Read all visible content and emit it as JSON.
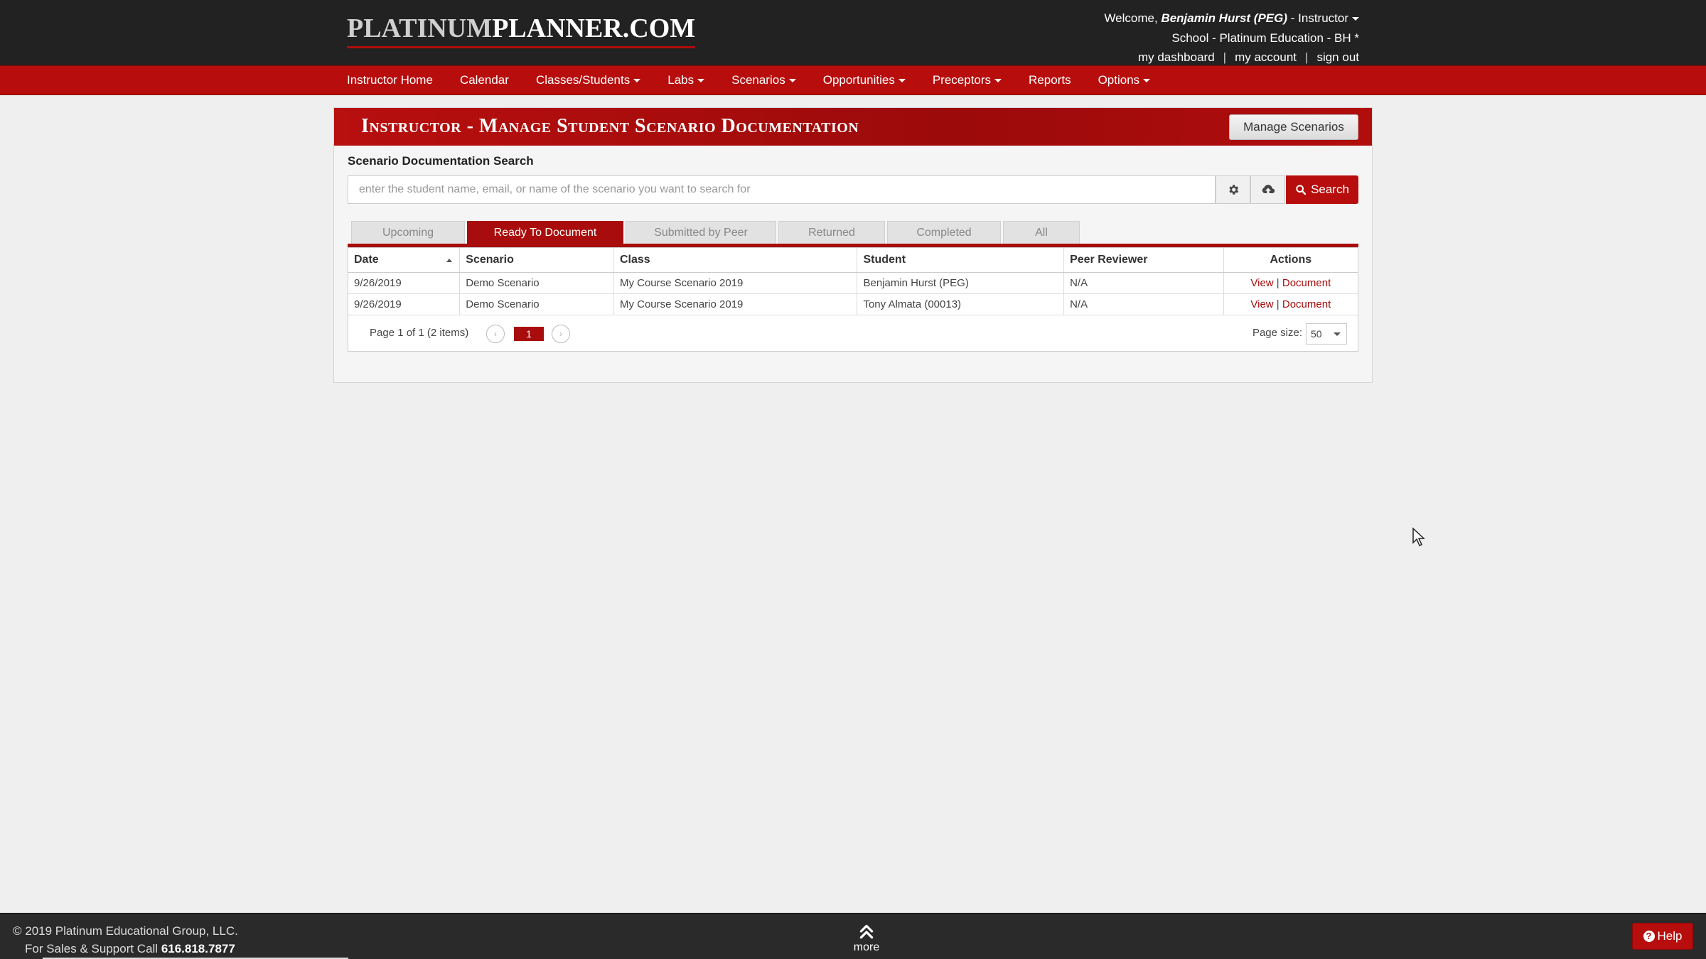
{
  "header": {
    "logo_left": "PLATINUM",
    "logo_right": "PLANNER.COM",
    "welcome_prefix": "Welcome, ",
    "user_name": "Benjamin Hurst (PEG)",
    "user_role": " - Instructor",
    "school": "School - Platinum Education - BH *",
    "links": [
      "my dashboard",
      "my account",
      "sign out"
    ]
  },
  "nav": {
    "items": [
      {
        "label": "Instructor Home",
        "dropdown": false
      },
      {
        "label": "Calendar",
        "dropdown": false
      },
      {
        "label": "Classes/Students",
        "dropdown": true
      },
      {
        "label": "Labs",
        "dropdown": true
      },
      {
        "label": "Scenarios",
        "dropdown": true
      },
      {
        "label": "Opportunities",
        "dropdown": true
      },
      {
        "label": "Preceptors",
        "dropdown": true
      },
      {
        "label": "Reports",
        "dropdown": false
      },
      {
        "label": "Options",
        "dropdown": true
      }
    ]
  },
  "panel": {
    "title": "Instructor - Manage Student Scenario Documentation",
    "manage_button": "Manage Scenarios",
    "search_label": "Scenario Documentation Search",
    "search_placeholder": "enter the student name, email, or name of the scenario you want to search for",
    "search_button": "Search"
  },
  "tabs": [
    {
      "label": "Upcoming",
      "active": false
    },
    {
      "label": "Ready To Document",
      "active": true
    },
    {
      "label": "Submitted by Peer",
      "active": false
    },
    {
      "label": "Returned",
      "active": false
    },
    {
      "label": "Completed",
      "active": false
    },
    {
      "label": "All",
      "active": false
    }
  ],
  "grid": {
    "columns": [
      "Date",
      "Scenario",
      "Class",
      "Student",
      "Peer Reviewer",
      "Actions"
    ],
    "rows": [
      {
        "date": "9/26/2019",
        "scenario": "Demo Scenario",
        "class": "My Course Scenario 2019",
        "student": "Benjamin Hurst (PEG)",
        "peer": "N/A",
        "view": "View",
        "sep": " | ",
        "document": "Document"
      },
      {
        "date": "9/26/2019",
        "scenario": "Demo Scenario",
        "class": "My Course Scenario 2019",
        "student": "Tony Almata (00013)",
        "peer": "N/A",
        "view": "View",
        "sep": " | ",
        "document": "Document"
      }
    ],
    "pager_info": "Page 1 of 1 (2 items)",
    "current_page": "1",
    "page_size_label": "Page size:",
    "page_size": "50"
  },
  "footer": {
    "copyright": "© 2019 Platinum Educational Group, LLC.",
    "support_prefix": "For Sales & Support Call ",
    "phone": "616.818.7877",
    "more": "more",
    "help": "Help"
  },
  "colors": {
    "brand_red": "#b70d0d",
    "header_dark": "#222222",
    "footer_dark": "#2a2a2a"
  }
}
